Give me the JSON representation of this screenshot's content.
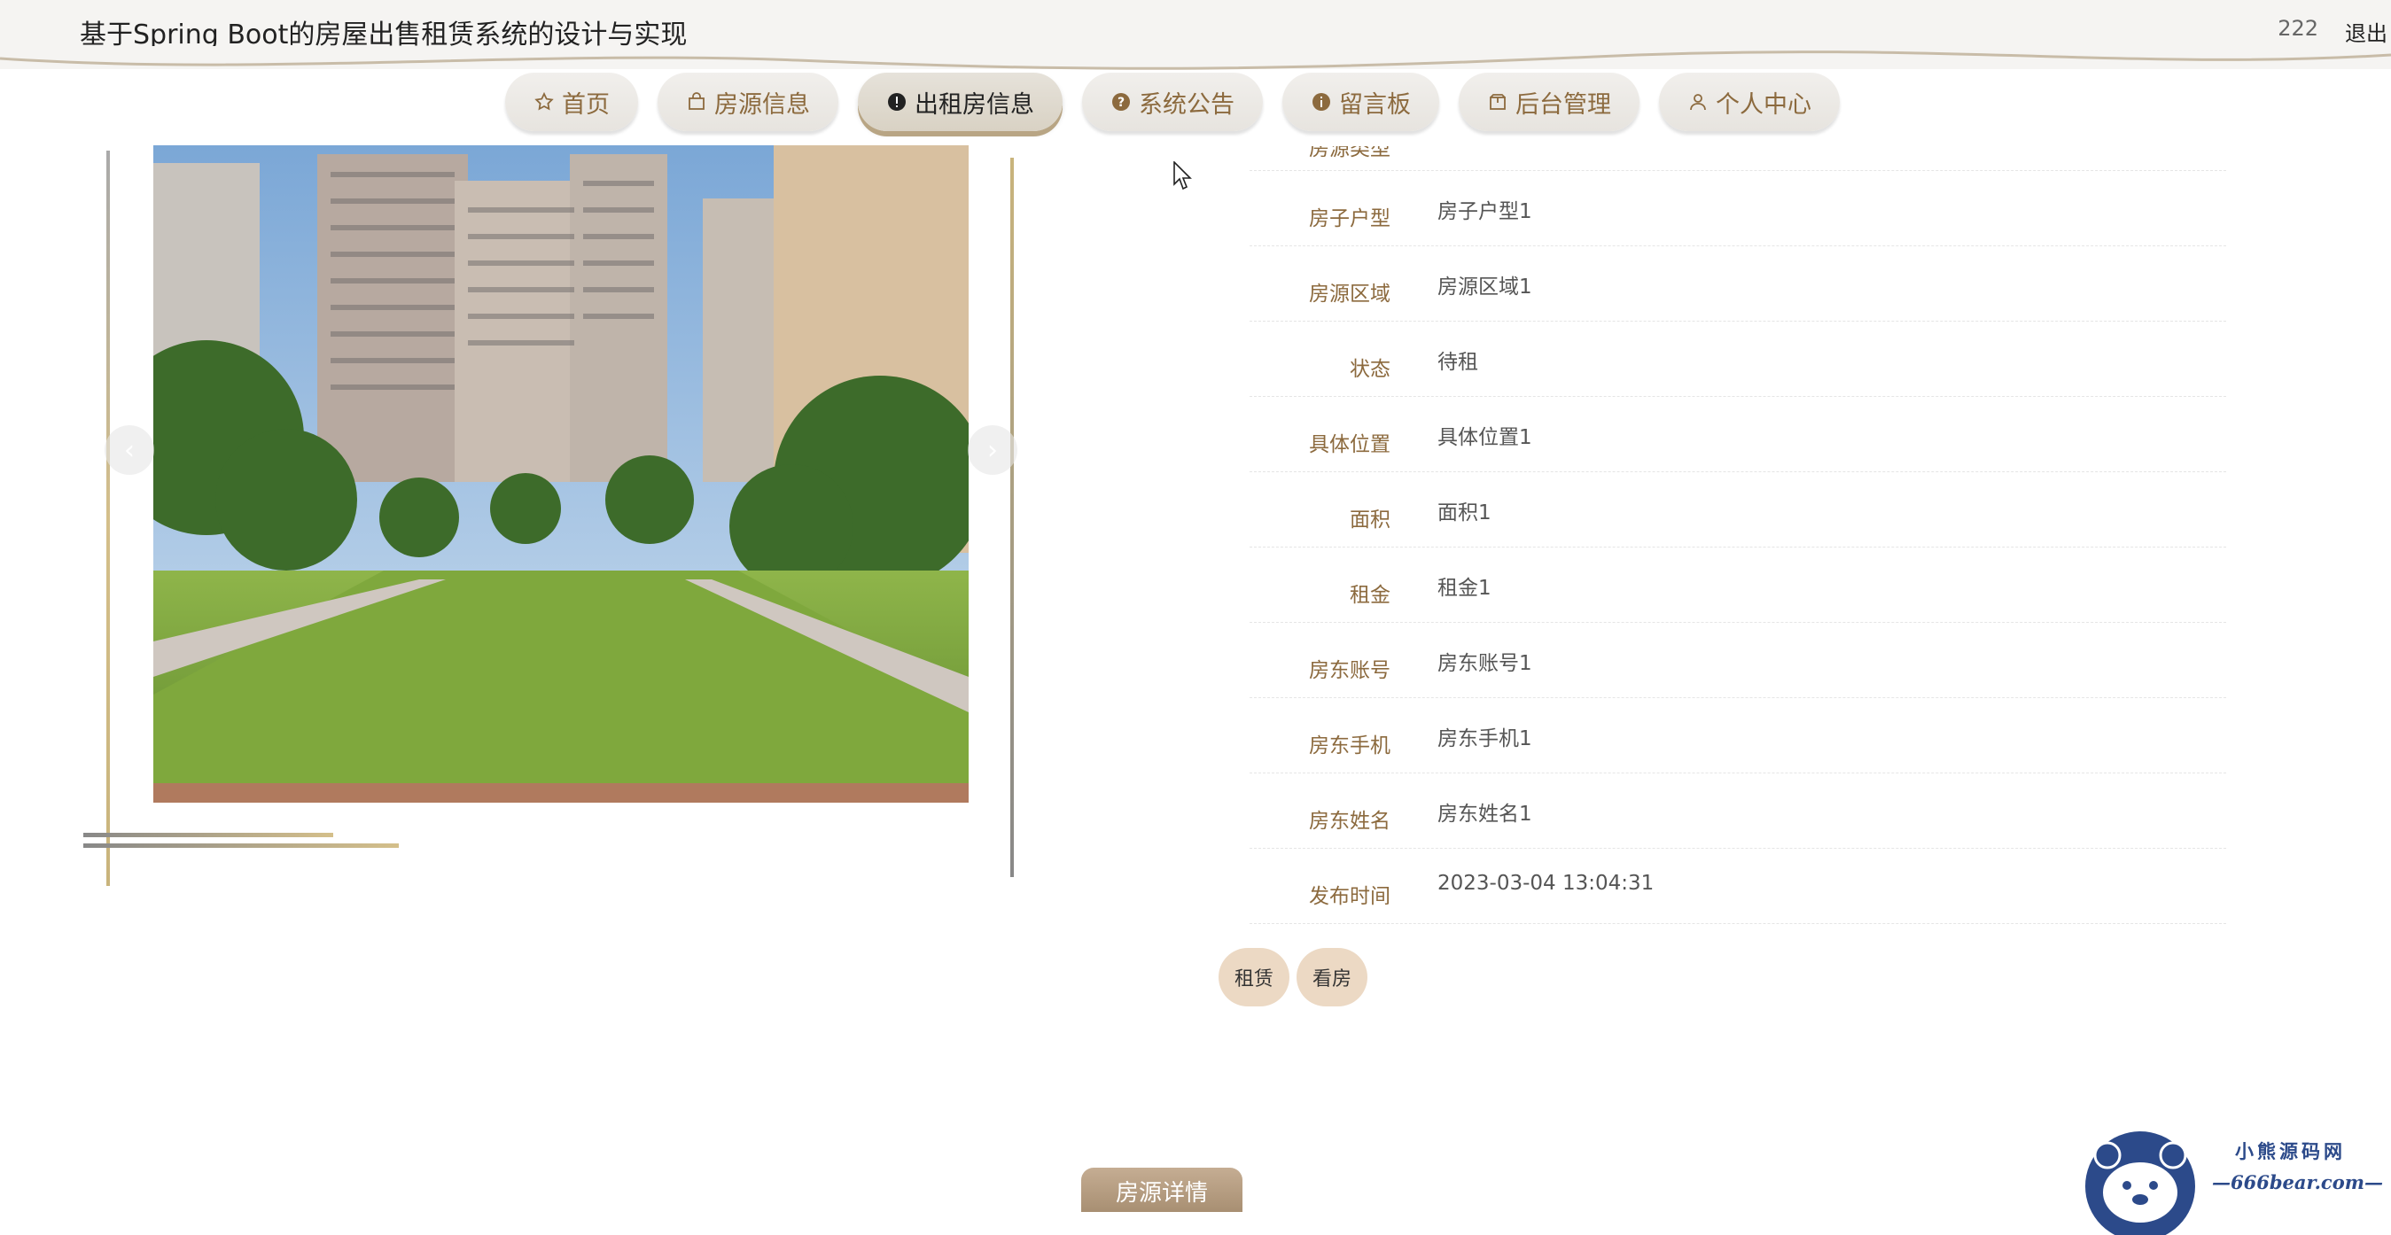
{
  "header": {
    "site_title": "基于Spring Boot的房屋出售租赁系统的设计与实现",
    "username": "222",
    "logout_label": "退出"
  },
  "nav": {
    "items": [
      {
        "label": "首页",
        "icon": "star-icon"
      },
      {
        "label": "房源信息",
        "icon": "bag-icon"
      },
      {
        "label": "出租房信息",
        "icon": "exclamation-circle-icon",
        "active": true
      },
      {
        "label": "系统公告",
        "icon": "question-circle-icon"
      },
      {
        "label": "留言板",
        "icon": "info-circle-icon"
      },
      {
        "label": "后台管理",
        "icon": "box-icon"
      },
      {
        "label": "个人中心",
        "icon": "person-icon"
      }
    ]
  },
  "gallery": {
    "prev_symbol": "‹",
    "next_symbol": "›"
  },
  "details": {
    "rows": [
      {
        "label": "房源类型",
        "value": ""
      },
      {
        "label": "房子户型",
        "value": "房子户型1"
      },
      {
        "label": "房源区域",
        "value": "房源区域1"
      },
      {
        "label": "状态",
        "value": "待租"
      },
      {
        "label": "具体位置",
        "value": "具体位置1"
      },
      {
        "label": "面积",
        "value": "面积1"
      },
      {
        "label": "租金",
        "value": "租金1"
      },
      {
        "label": "房东账号",
        "value": "房东账号1"
      },
      {
        "label": "房东手机",
        "value": "房东手机1"
      },
      {
        "label": "房东姓名",
        "value": "房东姓名1"
      },
      {
        "label": "发布时间",
        "value": "2023-03-04 13:04:31"
      }
    ]
  },
  "actions": {
    "rent_label": "租赁",
    "view_label": "看房"
  },
  "section_tab": {
    "label": "房源详情"
  },
  "watermark": {
    "title": "小熊源码网",
    "url": "—666bear.com—"
  },
  "colors": {
    "accent_brown": "#8c6a3e",
    "button_beige": "#ecd9c4",
    "watermark_blue": "#2c4a8a"
  }
}
